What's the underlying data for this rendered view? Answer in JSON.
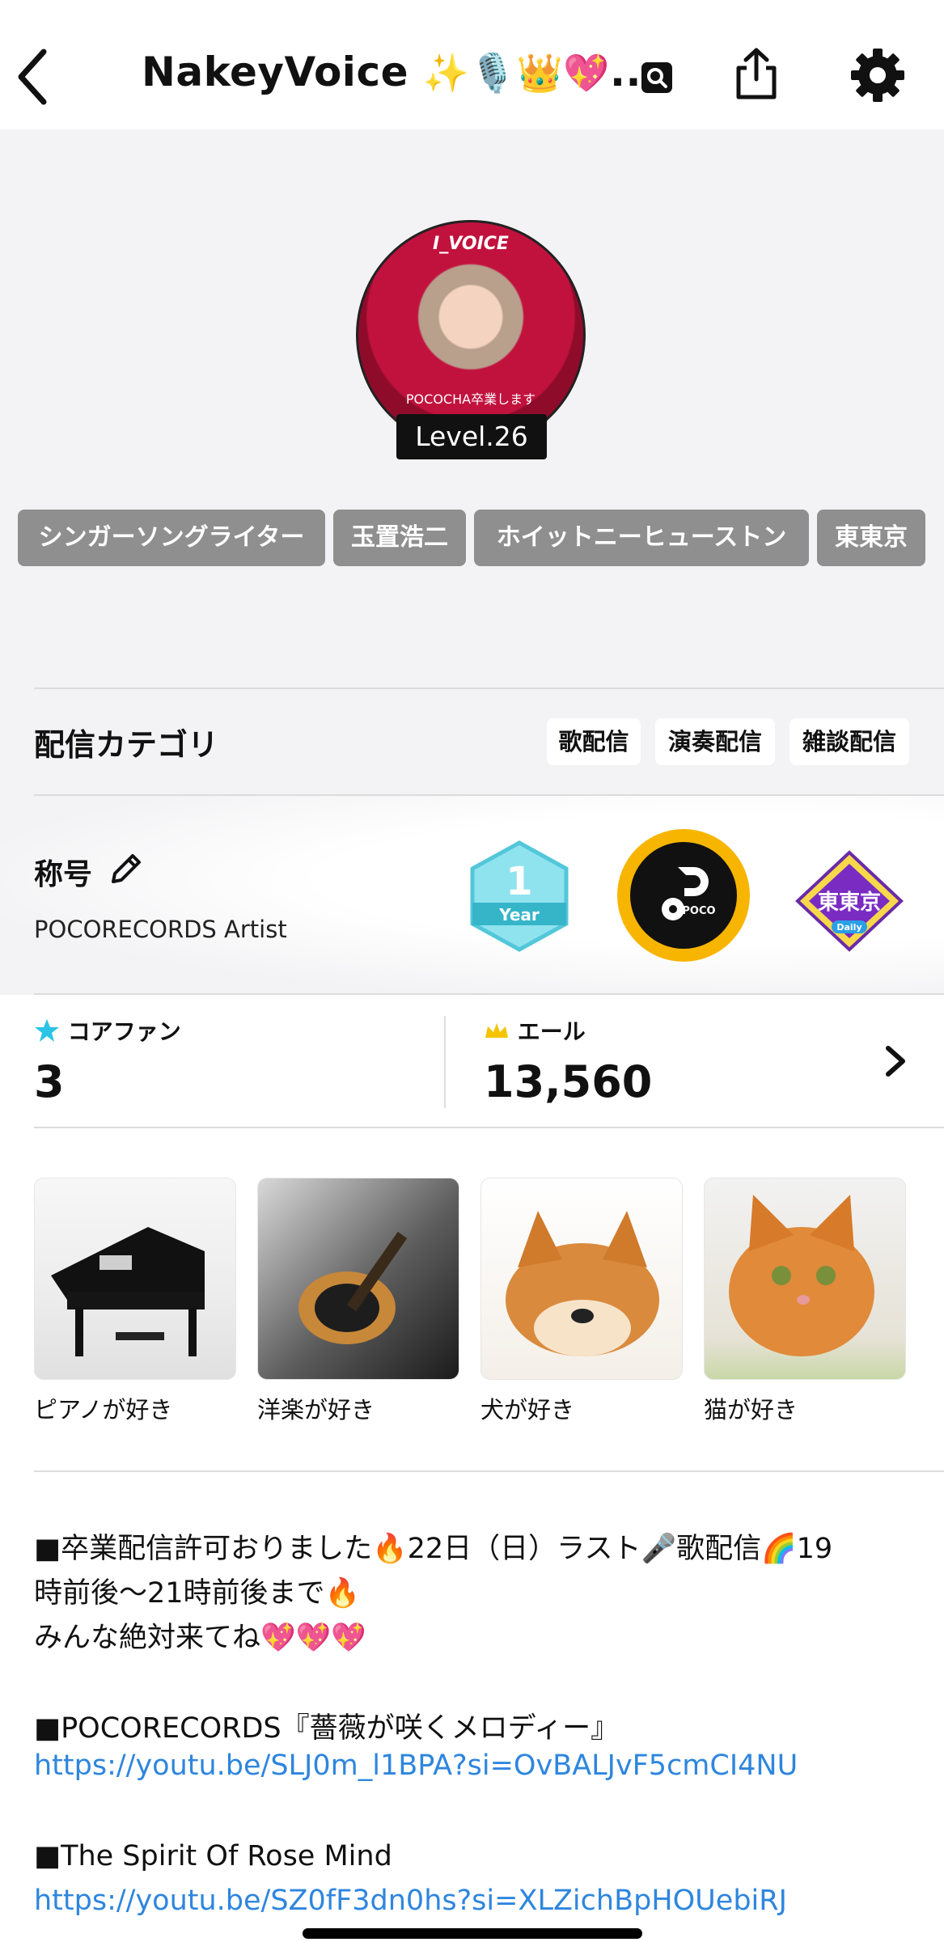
{
  "header": {
    "title": "NakeyVoice",
    "title_emoji": "✨🎙️👑💖",
    "title_ellipsis": "..."
  },
  "profile": {
    "avatar_top_text": "I_VOICE",
    "avatar_bottom_text": "POCOCHA卒業します",
    "level": "Level.26",
    "tags": [
      "シンガーソングライター",
      "玉置浩二",
      "ホイットニーヒューストン",
      "東東京"
    ]
  },
  "category": {
    "label": "配信カテゴリ",
    "items": [
      "歌配信",
      "演奏配信",
      "雑談配信"
    ]
  },
  "shougou": {
    "label": "称号",
    "value": "POCORECORDS Artist",
    "badges": {
      "year_number": "1",
      "year_label": "Year",
      "poco_label": "POCO",
      "daily_area": "東東京",
      "daily_label": "Daily"
    }
  },
  "stats": {
    "core_fan_label": "コアファン",
    "core_fan_value": "3",
    "yell_label": "エール",
    "yell_value": "13,560"
  },
  "interests": [
    {
      "label": "ピアノが好き"
    },
    {
      "label": "洋楽が好き"
    },
    {
      "label": "犬が好き"
    },
    {
      "label": "猫が好き"
    }
  ],
  "bio": {
    "line1": "■卒業配信許可おりました🔥22日（日）ラスト🎤歌配信🌈19",
    "line2": "時前後〜21時前後まで🔥",
    "line3": "みんな絶対来てね💖💖💖",
    "line4": "■POCORECORDS『薔薇が咲くメロディー』",
    "link1": "https://youtu.be/SLJ0m_l1BPA?si=OvBALJvF5cmCI4NU",
    "line5": "■The Spirit Of Rose Mind",
    "link2": "https://youtu.be/SZ0fF3dn0hs?si=XLZichBpHOUebiRJ"
  },
  "colors": {
    "accent_link": "#2e86de",
    "tag_bg": "#8f8f8f",
    "core_fan_star": "#29c4e6",
    "yell_icon": "#f5c400",
    "poco_gold": "#f7b500"
  }
}
